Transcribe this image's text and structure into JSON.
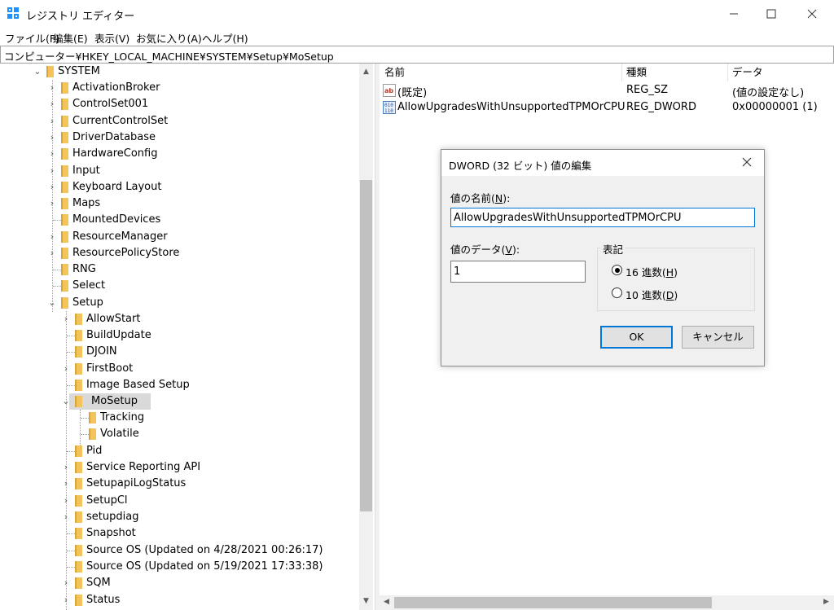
{
  "window": {
    "title": "レジストリ エディター"
  },
  "menu": [
    "ファイル(F)",
    "編集(E)",
    "表示(V)",
    "お気に入り(A)",
    "ヘルプ(H)"
  ],
  "address": "コンピューター¥HKEY_LOCAL_MACHINE¥SYSTEM¥Setup¥MoSetup",
  "tree": {
    "root": "SYSTEM",
    "level1_top": [
      "ActivationBroker",
      "ControlSet001",
      "CurrentControlSet",
      "DriverDatabase",
      "HardwareConfig",
      "Input",
      "Keyboard Layout",
      "Maps",
      "MountedDevices",
      "ResourceManager",
      "ResourcePolicyStore",
      "RNG",
      "Select"
    ],
    "setup": "Setup",
    "level2_top": [
      "AllowStart",
      "BuildUpdate",
      "DJOIN",
      "FirstBoot",
      "Image Based Setup"
    ],
    "mosetup": "MoSetup",
    "level3": [
      "Tracking",
      "Volatile"
    ],
    "level2_bottom": [
      "Pid",
      "Service Reporting API",
      "SetupapiLogStatus",
      "SetupCl",
      "setupdiag",
      "Snapshot",
      "Source OS (Updated on 4/28/2021 00:26:17)",
      "Source OS (Updated on 5/19/2021 17:33:38)",
      "SQM",
      "Status"
    ]
  },
  "list": {
    "headers": {
      "name": "名前",
      "type": "種類",
      "data": "データ"
    },
    "rows": [
      {
        "icon": "string-value-icon",
        "name": "(既定)",
        "type": "REG_SZ",
        "data": "(値の設定なし)"
      },
      {
        "icon": "binary-value-icon",
        "name": "AllowUpgradesWithUnsupportedTPMOrCPU",
        "type": "REG_DWORD",
        "data": "0x00000001 (1)"
      }
    ]
  },
  "dialog": {
    "title": "DWORD (32 ビット) 値の編集",
    "name_label": "値の名前(",
    "name_key": "N",
    "name_value": "AllowUpgradesWithUnsupportedTPMOrCPU",
    "data_label": "値のデータ(",
    "data_key": "V",
    "data_value": "1",
    "base_label": "表記",
    "hex_label": "16 進数(",
    "hex_key": "H",
    "dec_label": "10 進数(",
    "dec_key": "D",
    "selected_base": "hex",
    "ok_label": "OK",
    "cancel_label": "キャンセル"
  },
  "colors": {
    "accent": "#0078d7",
    "folder": "#f2c45a",
    "selection": "#d9d9d9"
  }
}
